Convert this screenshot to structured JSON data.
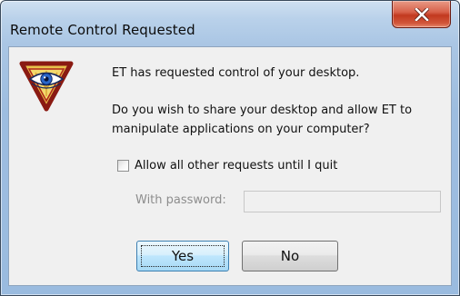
{
  "window": {
    "title": "Remote Control Requested",
    "close_icon": "close-icon"
  },
  "dialog": {
    "app_icon": "eye-triangle-icon",
    "message_primary": "ET has requested control of your desktop.",
    "message_secondary": "Do you wish to share your desktop and allow ET to manipulate applications on your computer?",
    "allow_checkbox_label": "Allow all other requests until I quit",
    "allow_checkbox_checked": false,
    "password_label": "With password:",
    "password_value": "",
    "password_enabled": false
  },
  "buttons": {
    "yes_label": "Yes",
    "no_label": "No",
    "default": "yes"
  },
  "colors": {
    "frame": "#9dbde0",
    "close_button": "#c94a30",
    "content_bg": "#f0f0f0",
    "default_button": "#bee6fd"
  }
}
